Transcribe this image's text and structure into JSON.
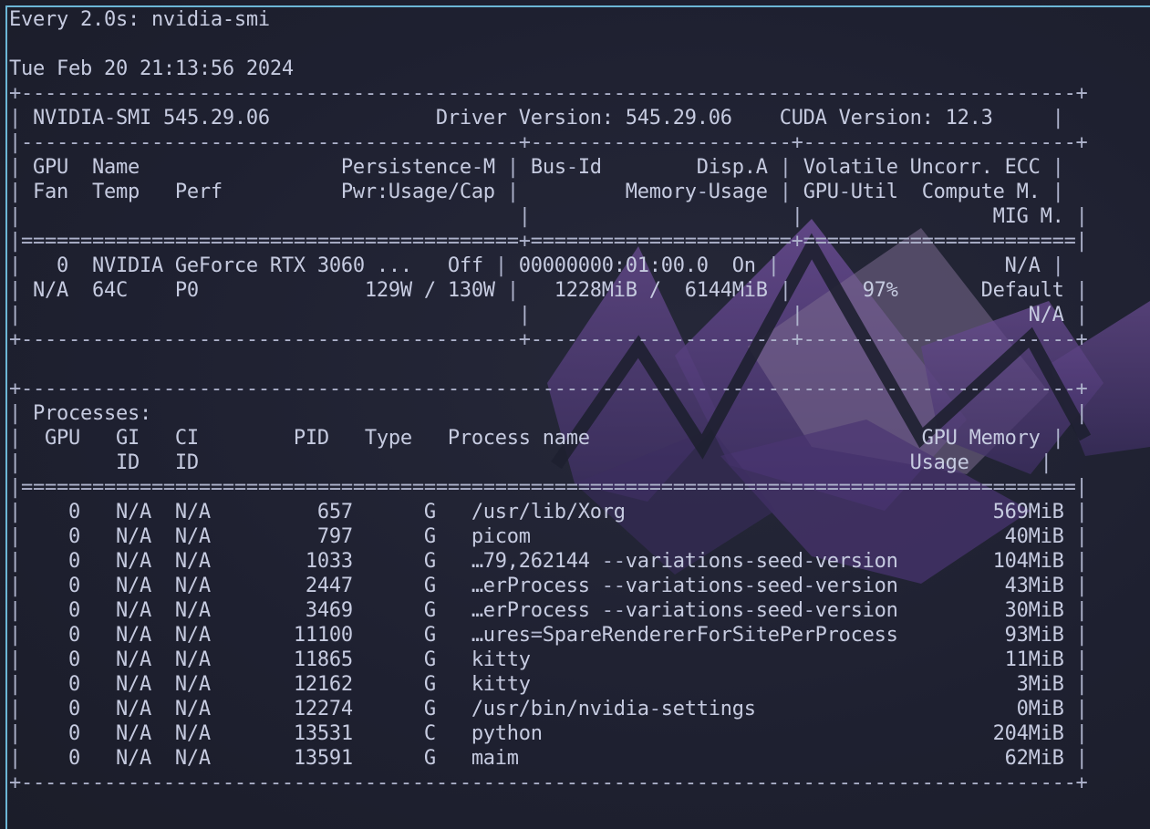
{
  "header": {
    "watch": "Every 2.0s: nvidia-smi",
    "datetime": "Tue Feb 20 21:13:56 2024"
  },
  "smi_version": "NVIDIA-SMI 545.29.06",
  "driver_version": "Driver Version: 545.29.06",
  "cuda_version": "CUDA Version: 12.3",
  "gpu_table": {
    "headers": {
      "gpu": "GPU",
      "name": "Name",
      "persistence": "Persistence-M",
      "bus_id": "Bus-Id",
      "disp": "Disp.A",
      "volatile_ecc": "Volatile Uncorr. ECC",
      "fan": "Fan",
      "temp": "Temp",
      "perf": "Perf",
      "pwr": "Pwr:Usage/Cap",
      "memory_usage": "Memory-Usage",
      "gpu_util": "GPU-Util",
      "compute_mode": "Compute M.",
      "mig_mode": "MIG M."
    },
    "gpus": [
      {
        "index": "0",
        "name": "NVIDIA GeForce RTX 3060 ...",
        "persistence": "Off",
        "bus_id": "00000000:01:00.0",
        "disp": "On",
        "ecc": "N/A",
        "fan": "N/A",
        "temp": "64C",
        "perf": "P0",
        "power": "129W / 130W",
        "memory": "1228MiB /  6144MiB",
        "util": "97%",
        "compute_mode": "Default",
        "mig": "N/A"
      }
    ]
  },
  "processes": {
    "title": "Processes:",
    "headers": {
      "gpu": "GPU",
      "gi": "GI",
      "ci": "CI",
      "pid": "PID",
      "type": "Type",
      "name": "Process name",
      "mem": "GPU Memory",
      "id": "ID",
      "usage": "Usage"
    },
    "rows": [
      {
        "gpu": "0",
        "gi": "N/A",
        "ci": "N/A",
        "pid": "657",
        "type": "G",
        "name": "/usr/lib/Xorg",
        "mem": "569MiB"
      },
      {
        "gpu": "0",
        "gi": "N/A",
        "ci": "N/A",
        "pid": "797",
        "type": "G",
        "name": "picom",
        "mem": "40MiB"
      },
      {
        "gpu": "0",
        "gi": "N/A",
        "ci": "N/A",
        "pid": "1033",
        "type": "G",
        "name": "…79,262144 --variations-seed-version",
        "mem": "104MiB"
      },
      {
        "gpu": "0",
        "gi": "N/A",
        "ci": "N/A",
        "pid": "2447",
        "type": "G",
        "name": "…erProcess --variations-seed-version",
        "mem": "43MiB"
      },
      {
        "gpu": "0",
        "gi": "N/A",
        "ci": "N/A",
        "pid": "3469",
        "type": "G",
        "name": "…erProcess --variations-seed-version",
        "mem": "30MiB"
      },
      {
        "gpu": "0",
        "gi": "N/A",
        "ci": "N/A",
        "pid": "11100",
        "type": "G",
        "name": "…ures=SpareRendererForSitePerProcess",
        "mem": "93MiB"
      },
      {
        "gpu": "0",
        "gi": "N/A",
        "ci": "N/A",
        "pid": "11865",
        "type": "G",
        "name": "kitty",
        "mem": "11MiB"
      },
      {
        "gpu": "0",
        "gi": "N/A",
        "ci": "N/A",
        "pid": "12162",
        "type": "G",
        "name": "kitty",
        "mem": "3MiB"
      },
      {
        "gpu": "0",
        "gi": "N/A",
        "ci": "N/A",
        "pid": "12274",
        "type": "G",
        "name": "/usr/bin/nvidia-settings",
        "mem": "0MiB"
      },
      {
        "gpu": "0",
        "gi": "N/A",
        "ci": "N/A",
        "pid": "13531",
        "type": "C",
        "name": "python",
        "mem": "204MiB"
      },
      {
        "gpu": "0",
        "gi": "N/A",
        "ci": "N/A",
        "pid": "13591",
        "type": "G",
        "name": "maim",
        "mem": "62MiB"
      }
    ]
  },
  "colors": {
    "background": "#1e2030",
    "text": "#c6cbe0",
    "border": "#aeb3cc",
    "window_accent": "#6cb6d6",
    "wallpaper_accent": "#5b3f86"
  }
}
